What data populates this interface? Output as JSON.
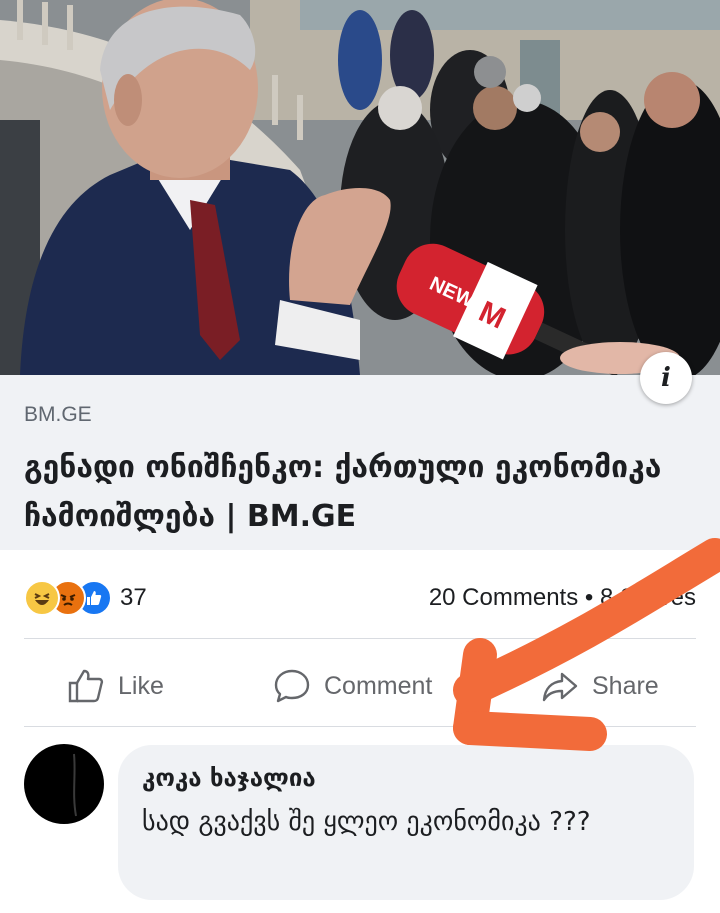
{
  "post": {
    "info_icon": "info-icon",
    "photo_mic_text": "NEWS",
    "photo_mic_logo": "M"
  },
  "link": {
    "domain": "BM.GE",
    "title": "გენადი ონიშჩენკო: ქართული ეკონომიკა ჩამოიშლება | BM.GE"
  },
  "stats": {
    "reactions": [
      "haha-icon",
      "angry-icon",
      "like-icon"
    ],
    "reaction_count": "37",
    "comments_shares": "20 Comments • 8 Shares"
  },
  "actions": {
    "like": "Like",
    "comment": "Comment",
    "share": "Share"
  },
  "comment": {
    "author": "კოკა ხაჯალია",
    "text": "სად გვაქვს შე ყლეო ეკონომიკა ???"
  },
  "colors": {
    "arrow": "#f26b3a",
    "link_box": "#f0f2f5",
    "reaction_like": "#1877f2"
  }
}
